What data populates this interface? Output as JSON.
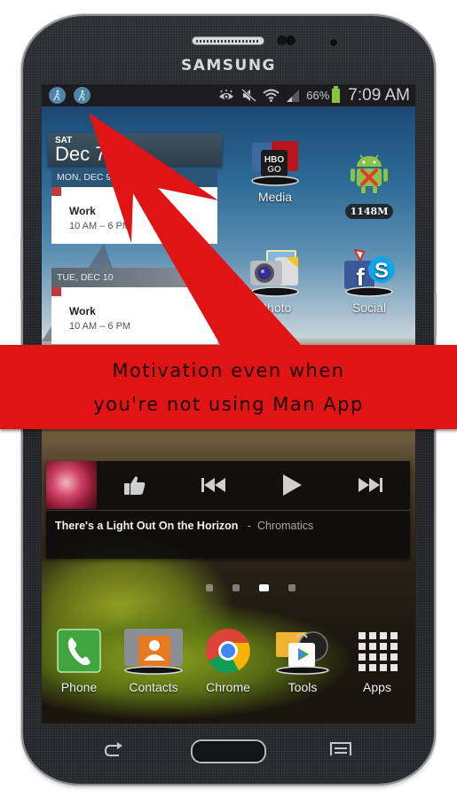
{
  "device": {
    "brand": "SAMSUNG"
  },
  "statusbar": {
    "left_icons": [
      "running-man-notification-icon",
      "running-man-notification-icon"
    ],
    "right_icons": [
      "eye-smart-stay-icon",
      "mute-icon",
      "wifi-icon",
      "signal-icon"
    ],
    "battery_percent": "66%",
    "battery_level": 0.66,
    "time": "7:09 AM",
    "battery_color": "#8bc53f"
  },
  "calendar_widget": {
    "today_dow": "SAT",
    "today_date": "Dec 7",
    "days": [
      {
        "header": "MON, DEC 9",
        "event_title": "Work",
        "event_time": "10 AM – 6 PM"
      },
      {
        "header": "TUE, DEC 10",
        "event_title": "Work",
        "event_time": "10 AM – 6 PM"
      }
    ],
    "event_color": "#c0393b"
  },
  "home_apps": [
    {
      "label": "Media",
      "icon": "hbo-go-folder-icon"
    },
    {
      "label": "1148M",
      "icon": "android-cleaner-icon"
    },
    {
      "label": "Photo",
      "icon": "camera-folder-icon"
    },
    {
      "label": "Social",
      "icon": "facebook-skype-folder-icon"
    }
  ],
  "music_widget": {
    "track_title": "There's a Light Out On the Horizon",
    "separator": "-",
    "artist": "Chromatics",
    "controls": [
      "thumbs-up",
      "previous",
      "play",
      "next"
    ]
  },
  "page_indicator": {
    "count": 4,
    "active_index": 2
  },
  "dock": [
    {
      "label": "Phone",
      "icon": "phone-icon"
    },
    {
      "label": "Contacts",
      "icon": "contacts-icon"
    },
    {
      "label": "Chrome",
      "icon": "chrome-icon"
    },
    {
      "label": "Tools",
      "icon": "tools-folder-icon"
    },
    {
      "label": "Apps",
      "icon": "apps-grid-icon"
    }
  ],
  "softkeys": [
    "back",
    "home",
    "menu"
  ],
  "promo": {
    "banner_line1": "Motivation even when",
    "banner_line2": "you're not using Man App",
    "accent_color": "#e01414"
  }
}
